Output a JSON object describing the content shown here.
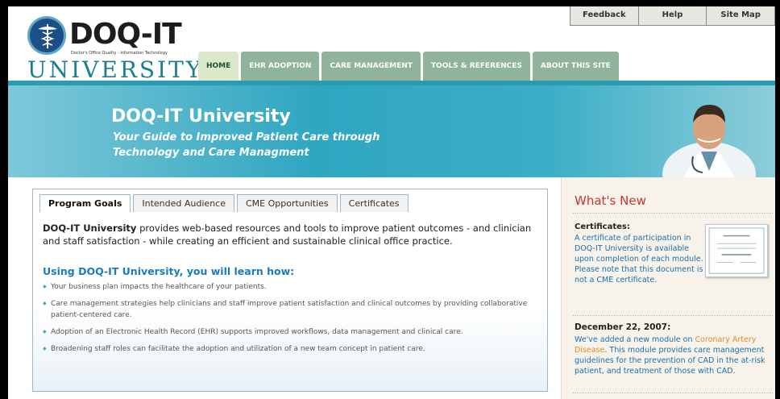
{
  "header": {
    "logo_main": "DOQ-IT",
    "logo_sub": "Doctor's Office Quality - Information Technology",
    "logo_university": "UNIVERSITY",
    "top_links": [
      "Feedback",
      "Help",
      "Site Map"
    ],
    "nav": [
      "HOME",
      "EHR ADOPTION",
      "CARE MANAGEMENT",
      "TOOLS & REFERENCES",
      "ABOUT THIS SITE"
    ]
  },
  "banner": {
    "title": "DOQ-IT University",
    "subtitle": "Your Guide to Improved Patient Care through Technology and Care Managment"
  },
  "main": {
    "tabs": [
      "Program Goals",
      "Intended Audience",
      "CME Opportunities",
      "Certificates"
    ],
    "intro_bold": "DOQ-IT University",
    "intro_rest": " provides web-based resources and tools to improve patient outcomes - and clinician and staff satisfaction - while creating an efficient and sustainable clinical office practice.",
    "learn_heading": "Using DOQ-IT University, you will learn how:",
    "bullets": [
      "Your business plan impacts the healthcare of your patients.",
      "Care management strategies help clinicians and staff improve patient satisfaction and clinical outcomes by providing collaborative patient-centered care.",
      "Adoption of an Electronic Health Record (EHR) supports improved workflows, data management and clinical care.",
      "Broadening staff roles can facilitate the adoption and utilization of a new team concept in patient care."
    ]
  },
  "whats_new": {
    "title": "What's New",
    "cert_heading": "Certificates:",
    "cert_body": "A certificate of participation in DOQ-IT University is available upon completion of each module. Please note that this document is not a CME certificate.",
    "dec_heading": "December 22, 2007:",
    "dec_body_1": "We've added a new module on ",
    "dec_link": "Coronary Artery Disease",
    "dec_body_2": ". This module provides care management guidelines for the prevention of CAD in the at-risk patient, and treatment of those with CAD."
  }
}
